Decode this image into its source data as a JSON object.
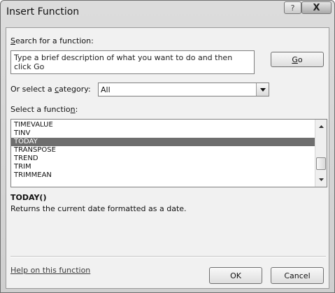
{
  "window": {
    "title": "Insert Function",
    "help_button_glyph": "?",
    "close_button_glyph": "X"
  },
  "search": {
    "label_prefix": "",
    "label_accel": "S",
    "label_rest": "earch for a function:",
    "text": "Type a brief description of what you want to do and then click Go",
    "go_prefix": "",
    "go_accel": "G",
    "go_rest": "o"
  },
  "category": {
    "label_prefix": "Or select a ",
    "label_accel": "c",
    "label_rest": "ategory:",
    "selected": "All",
    "arrow_icon": "triangle-down-icon"
  },
  "function_list": {
    "label_prefix": "Select a functio",
    "label_accel": "n",
    "label_rest": ":",
    "items": [
      "TIMEVALUE",
      "TINV",
      "TODAY",
      "TRANSPOSE",
      "TREND",
      "TRIM",
      "TRIMMEAN"
    ],
    "selected_index": 2
  },
  "details": {
    "signature": "TODAY()",
    "description": "Returns the current date formatted as a date."
  },
  "footer": {
    "help_link": "Help on this function",
    "ok": "OK",
    "cancel": "Cancel"
  }
}
